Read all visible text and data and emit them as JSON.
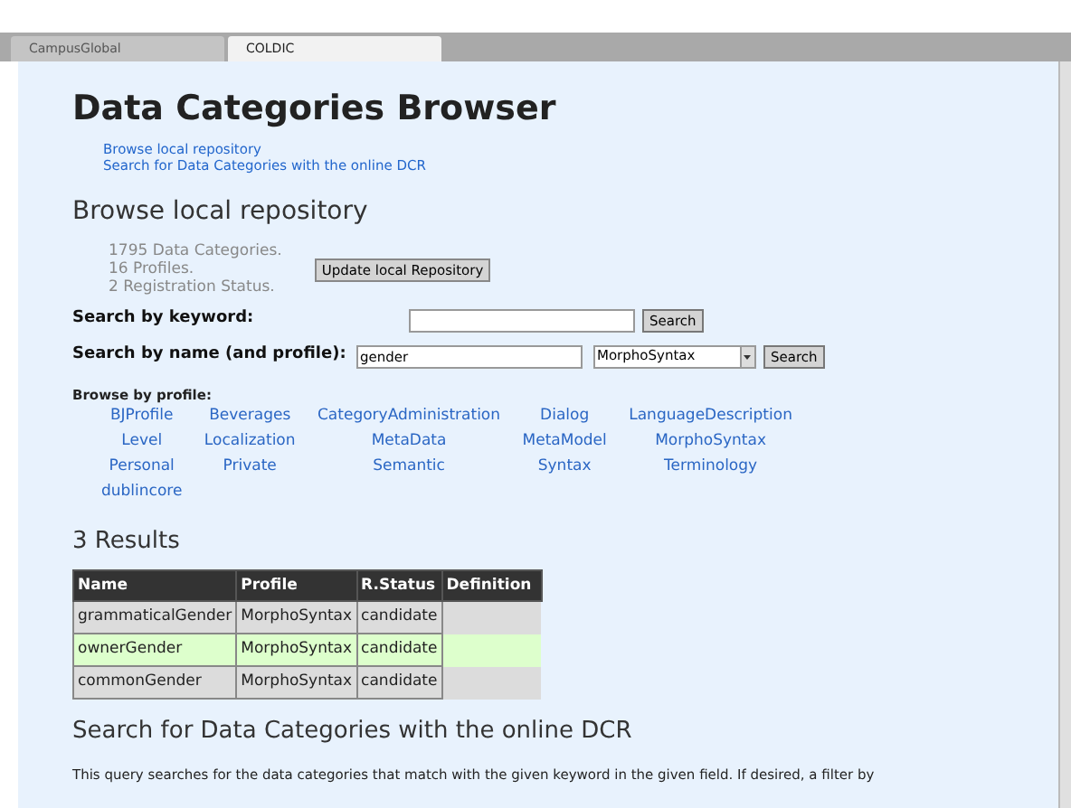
{
  "browser_tabs": [
    {
      "label": "CampusGlobal",
      "selected": false
    },
    {
      "label": "COLDIC",
      "selected": true
    }
  ],
  "title": "Data Categories Browser",
  "nav_links": [
    "Browse local repository",
    "Search for Data Categories with the online DCR"
  ],
  "local": {
    "heading": "Browse local repository",
    "stats": [
      "1795 Data Categories.",
      "16 Profiles.",
      "2 Registration Status."
    ],
    "update_button": "Update local Repository"
  },
  "keyword_search": {
    "label": "Search by keyword:",
    "button": "Search"
  },
  "name_search": {
    "label": "Search by name (and profile):",
    "value": "gender",
    "profile": "MorphoSyntax",
    "button": "Search"
  },
  "browse_by_profile": {
    "label": "Browse by profile:",
    "profiles": [
      "BJProfile",
      "Beverages",
      "CategoryAdministration",
      "Dialog",
      "LanguageDescription",
      "Level",
      "Localization",
      "MetaData",
      "MetaModel",
      "MorphoSyntax",
      "Personal",
      "Private",
      "Semantic",
      "Syntax",
      "Terminology",
      "dublincore"
    ]
  },
  "results": {
    "heading": "3 Results",
    "columns": [
      "Name",
      "Profile",
      "R.Status",
      "Definition"
    ],
    "rows": [
      {
        "cells": [
          "grammaticalGender",
          "MorphoSyntax",
          "candidate"
        ],
        "highlighted": false
      },
      {
        "cells": [
          "ownerGender",
          "MorphoSyntax",
          "candidate"
        ],
        "highlighted": true
      },
      {
        "cells": [
          "commonGender",
          "MorphoSyntax",
          "candidate"
        ],
        "highlighted": false
      }
    ]
  },
  "online": {
    "heading": "Search for Data Categories with the online DCR",
    "text": "This query searches for the data categories that match with the given keyword in the given field. If desired, a filter by"
  }
}
